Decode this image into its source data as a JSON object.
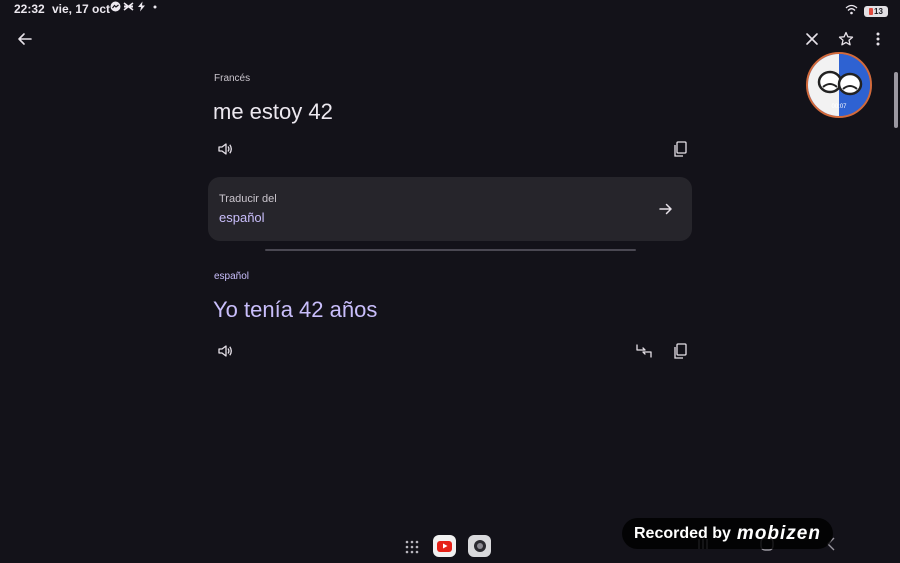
{
  "status_bar": {
    "time": "22:32",
    "date": "vie, 17 oct",
    "battery_level": "13"
  },
  "source": {
    "language": "Francés",
    "text": "me estoy 42"
  },
  "translate_from_card": {
    "title": "Traducir del",
    "language": "español"
  },
  "target": {
    "language": "español",
    "text": "Yo tenía 42 años"
  },
  "recorder": {
    "elapsed": "00:07"
  },
  "watermark": {
    "recorded_by": "Recorded by",
    "brand": "mobizen"
  },
  "colors": {
    "background": "#131219",
    "accent": "#c9befb",
    "card": "#26252b"
  }
}
